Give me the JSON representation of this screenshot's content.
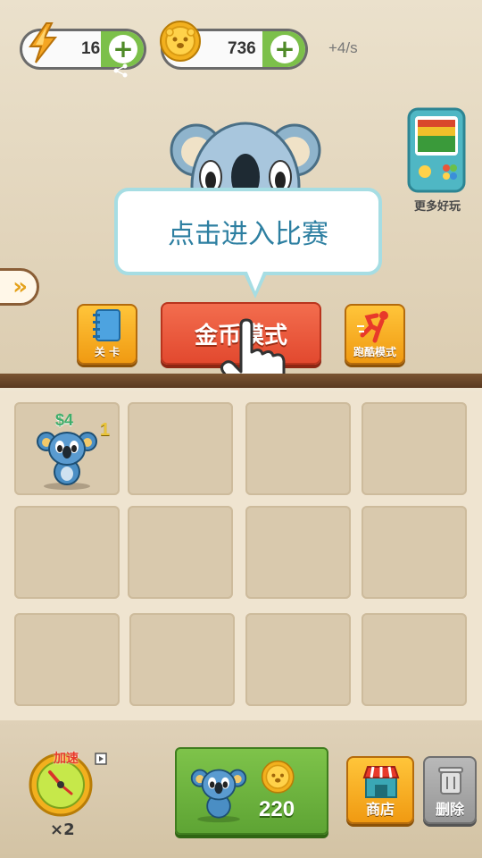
{
  "hud": {
    "energy_value": "16",
    "coins_value": "736",
    "rate": "+4/s"
  },
  "tooltip": {
    "text": "点击进入比赛"
  },
  "modes": {
    "level_label": "关 卡",
    "coin_mode_label": "金币模式",
    "parkour_label": "跑酷模式"
  },
  "more_games": {
    "label": "更多好玩"
  },
  "grid": {
    "cells": [
      {
        "price": "$4",
        "level": "1",
        "occupied": true
      },
      {
        "occupied": false
      },
      {
        "occupied": false
      },
      {
        "occupied": false
      },
      {
        "occupied": false
      },
      {
        "occupied": false
      },
      {
        "occupied": false
      },
      {
        "occupied": false
      },
      {
        "occupied": false
      },
      {
        "occupied": false
      },
      {
        "occupied": false
      },
      {
        "occupied": false
      }
    ]
  },
  "bottom": {
    "speed_label": "加速",
    "speed_multiplier": "×2",
    "buy_price": "220",
    "shop_label": "商店",
    "delete_label": "删除"
  },
  "colors": {
    "accent_green": "#7cc04a",
    "tooltip_text": "#2d7fa1",
    "coin_mode_red": "#e2492f",
    "price_green": "#3fae6b"
  }
}
